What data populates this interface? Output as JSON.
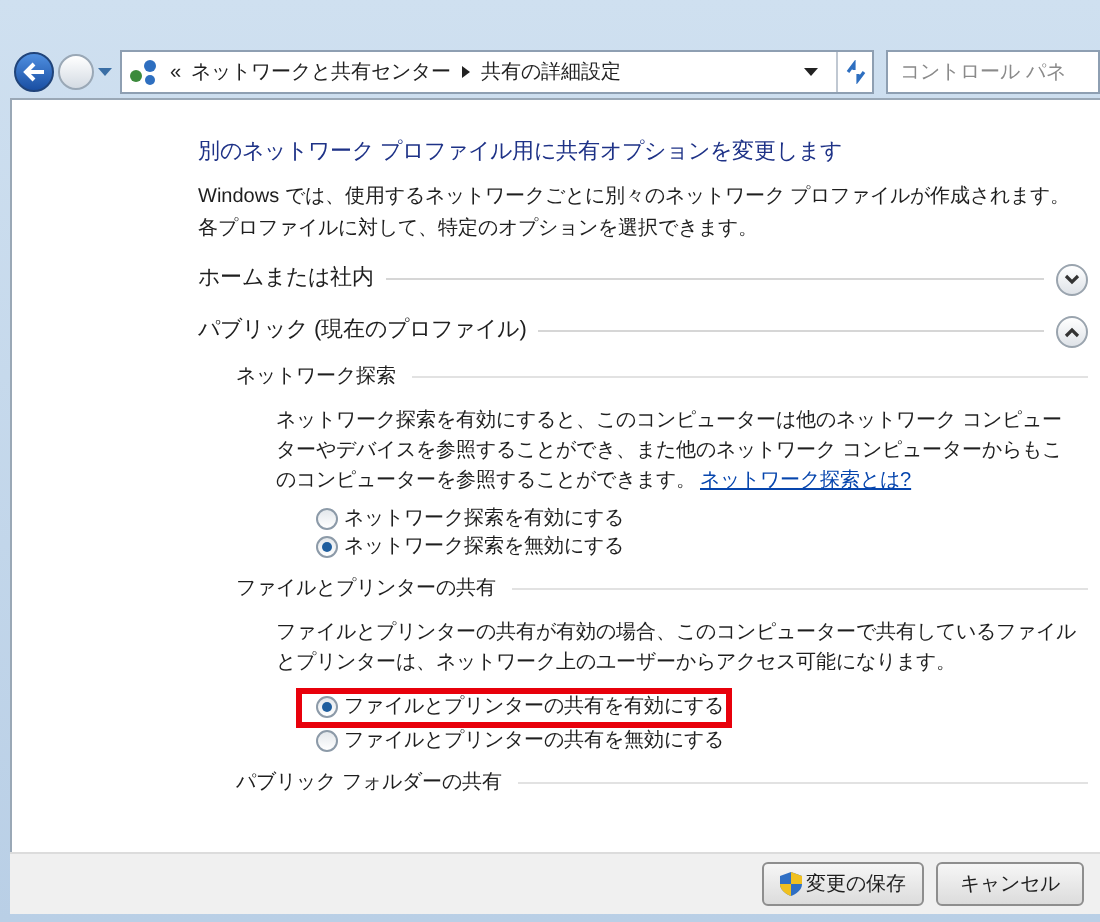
{
  "nav": {
    "address_parts": [
      "«",
      "ネットワークと共有センター",
      "共有の詳細設定"
    ],
    "search": {
      "placeholder": "コントロール パネ"
    }
  },
  "heading": "別のネットワーク プロファイル用に共有オプションを変更します",
  "intro": "Windows では、使用するネットワークごとに別々のネットワーク プロファイルが作成されます。各プロファイルに対して、特定のオプションを選択できます。",
  "profiles": [
    {
      "title": "ホームまたは社内",
      "expanded": false
    },
    {
      "title": "パブリック (現在のプロファイル)",
      "expanded": true,
      "groups": [
        {
          "title": "ネットワーク探索",
          "description": "ネットワーク探索を有効にすると、このコンピューターは他のネットワーク コンピューターやデバイスを参照することができ、また他のネットワーク コンピューターからもこのコンピューターを参照することができます。",
          "link": "ネットワーク探索とは?",
          "options": [
            {
              "label": "ネットワーク探索を有効にする",
              "selected": false,
              "highlighted": false
            },
            {
              "label": "ネットワーク探索を無効にする",
              "selected": true,
              "highlighted": false
            }
          ]
        },
        {
          "title": "ファイルとプリンターの共有",
          "description": "ファイルとプリンターの共有が有効の場合、このコンピューターで共有しているファイルとプリンターは、ネットワーク上のユーザーからアクセス可能になります。",
          "options": [
            {
              "label": "ファイルとプリンターの共有を有効にする",
              "selected": true,
              "highlighted": true
            },
            {
              "label": "ファイルとプリンターの共有を無効にする",
              "selected": false,
              "highlighted": false
            }
          ]
        },
        {
          "title": "パブリック フォルダーの共有"
        }
      ]
    }
  ],
  "buttons": [
    {
      "label": "変更の保存",
      "kind": "shield"
    },
    {
      "label": "キャンセル",
      "kind": "plain"
    }
  ]
}
